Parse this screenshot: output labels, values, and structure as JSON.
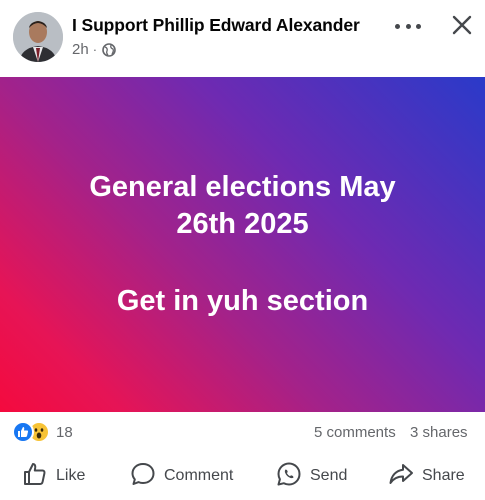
{
  "post": {
    "author": "I Support Phillip Edward Alexander",
    "time": "2h",
    "separator": "·",
    "privacy_icon": "globe-icon",
    "text_line1": "General elections May",
    "text_line2": "26th 2025",
    "text_line3": "Get in yuh section"
  },
  "stats": {
    "reaction_count": "18",
    "comments": "5 comments",
    "shares": "3 shares"
  },
  "actions": {
    "like": "Like",
    "comment": "Comment",
    "send": "Send",
    "share": "Share"
  },
  "colors": {
    "gradient_start": "#2a3ac9",
    "gradient_end": "#f40a3e",
    "like_blue": "#1877f2",
    "text_secondary": "#65676b"
  }
}
